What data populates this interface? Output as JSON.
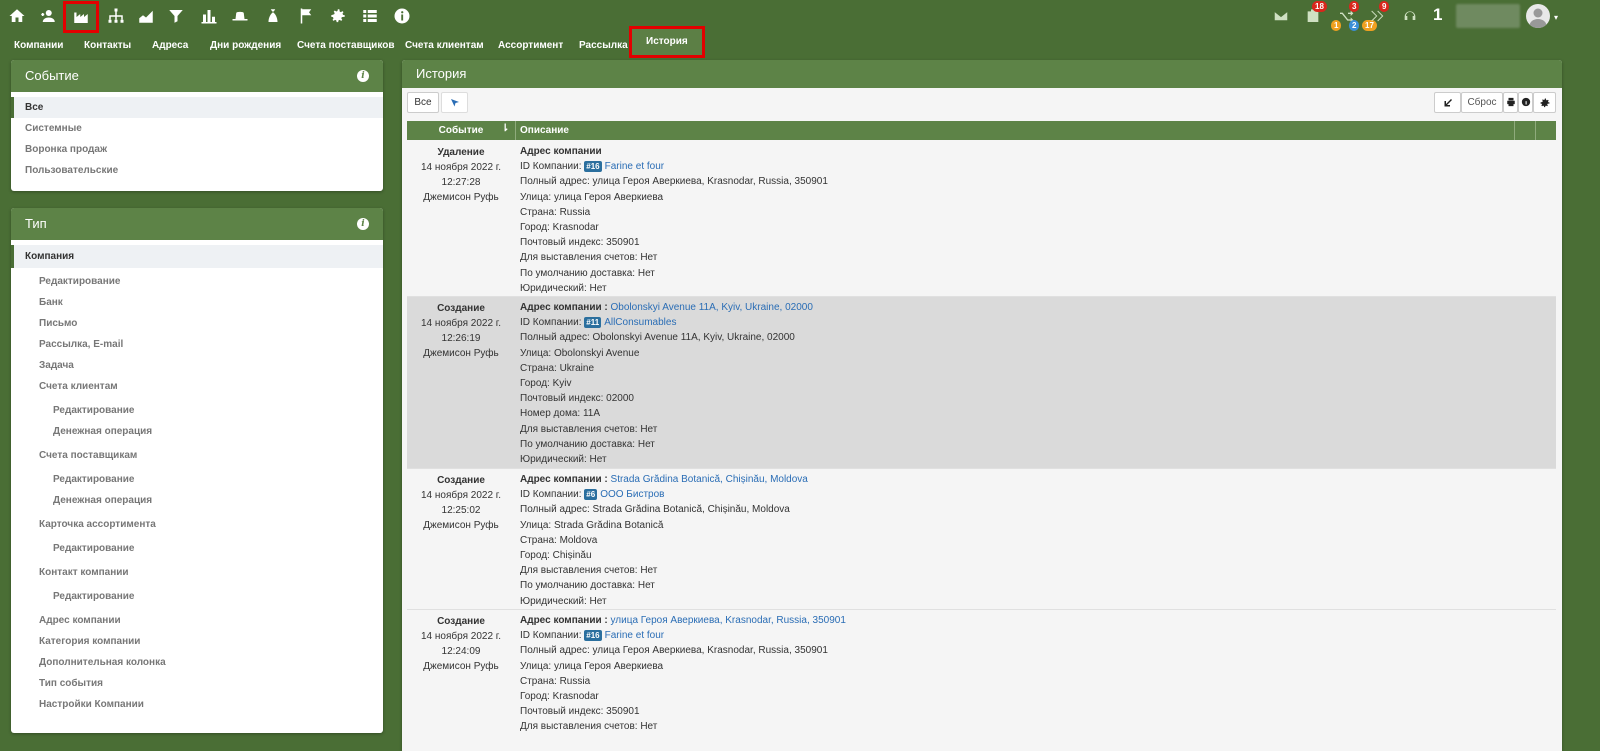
{
  "toolbar_icons": [
    "home-icon",
    "user-add-icon",
    "factory-icon",
    "org-chart-icon",
    "area-chart-icon",
    "filter-icon",
    "bar-chart-icon",
    "hat-icon",
    "money-bag-icon",
    "flag-icon",
    "gear-icon",
    "list-icon",
    "info-icon"
  ],
  "nav": {
    "tabs": [
      "Компании",
      "Контакты",
      "Адреса",
      "Дни рождения",
      "Счета поставщиков",
      "Счета клиентам",
      "Ассортимент",
      "Рассылка",
      "История"
    ],
    "active": "История"
  },
  "right": {
    "badge_tasks": "18",
    "badge_tasks_sub": "1",
    "badge_shuffle": "3",
    "badge_shuffle_sub1": "2",
    "badge_shuffle_sub2": "17",
    "badge_forward": "9",
    "counter": "1"
  },
  "event_panel": {
    "title": "Событие",
    "items": [
      "Все",
      "Системные",
      "Воронка продаж",
      "Пользовательские"
    ]
  },
  "type_panel": {
    "title": "Тип",
    "items": [
      "Компания",
      "Редактирование",
      "Банк",
      "Письмо",
      "Рассылка, E-mail",
      "Задача",
      "Счета клиентам",
      "Редактирование",
      "Денежная операция",
      "Счета поставщикам",
      "Редактирование",
      "Денежная операция",
      "Карточка ассортимента",
      "Редактирование",
      "Контакт компании",
      "Редактирование",
      "Адрес компании",
      "Категория компании",
      "Дополнительная колонка",
      "Тип события",
      "Настройки Компании"
    ]
  },
  "history": {
    "title": "История",
    "filter_all": "Все",
    "reset": "Сброс",
    "col_event": "Событие",
    "col_desc": "Описание",
    "rows": [
      {
        "event": "Удаление",
        "date": "14 ноября 2022 г.",
        "time": "12:27:28",
        "user": "Джемисон Руфь",
        "heading": "Адрес компании",
        "heading_link": "",
        "id_label": "ID Компании:",
        "id_tag": "#16",
        "id_name": "Farine et four",
        "lines": [
          "Полный адрес: улица Героя Аверкиева, Krasnodar, Russia, 350901",
          "Улица: улица Героя Аверкиева",
          "Страна: Russia",
          "Город: Krasnodar",
          "Почтовый индекс: 350901",
          "Для выставления счетов: Нет",
          "По умолчанию доставка: Нет",
          "Юридический: Нет"
        ]
      },
      {
        "event": "Создание",
        "date": "14 ноября 2022 г.",
        "time": "12:26:19",
        "user": "Джемисон Руфь",
        "heading": "Адрес компании :",
        "heading_link": "Obolonskyi Avenue 11A, Kyiv, Ukraine, 02000",
        "id_label": "ID Компании:",
        "id_tag": "#11",
        "id_name": "AllConsumables",
        "lines": [
          "Полный адрес: Obolonskyi Avenue 11A, Kyiv, Ukraine, 02000",
          "Улица: Obolonskyi Avenue",
          "Страна: Ukraine",
          "Город: Kyiv",
          "Почтовый индекс: 02000",
          "Номер дома: 11A",
          "Для выставления счетов: Нет",
          "По умолчанию доставка: Нет",
          "Юридический: Нет"
        ]
      },
      {
        "event": "Создание",
        "date": "14 ноября 2022 г.",
        "time": "12:25:02",
        "user": "Джемисон Руфь",
        "heading": "Адрес компании :",
        "heading_link": "Strada Grădina Botanică, Chișinău, Moldova",
        "id_label": "ID Компании:",
        "id_tag": "#6",
        "id_name": "ООО Бистров",
        "lines": [
          "Полный адрес: Strada Grădina Botanică, Chișinău, Moldova",
          "Улица: Strada Grădina Botanică",
          "Страна: Moldova",
          "Город: Chișinău",
          "Для выставления счетов: Нет",
          "По умолчанию доставка: Нет",
          "Юридический: Нет"
        ]
      },
      {
        "event": "Создание",
        "date": "14 ноября 2022 г.",
        "time": "12:24:09",
        "user": "Джемисон Руфь",
        "heading": "Адрес компании :",
        "heading_link": "улица Героя Аверкиева, Krasnodar, Russia, 350901",
        "id_label": "ID Компании:",
        "id_tag": "#16",
        "id_name": "Farine et four",
        "lines": [
          "Полный адрес: улица Героя Аверкиева, Krasnodar, Russia, 350901",
          "Улица: улица Героя Аверкиева",
          "Страна: Russia",
          "Город: Krasnodar",
          "Почтовый индекс: 350901",
          "Для выставления счетов: Нет"
        ]
      }
    ]
  }
}
